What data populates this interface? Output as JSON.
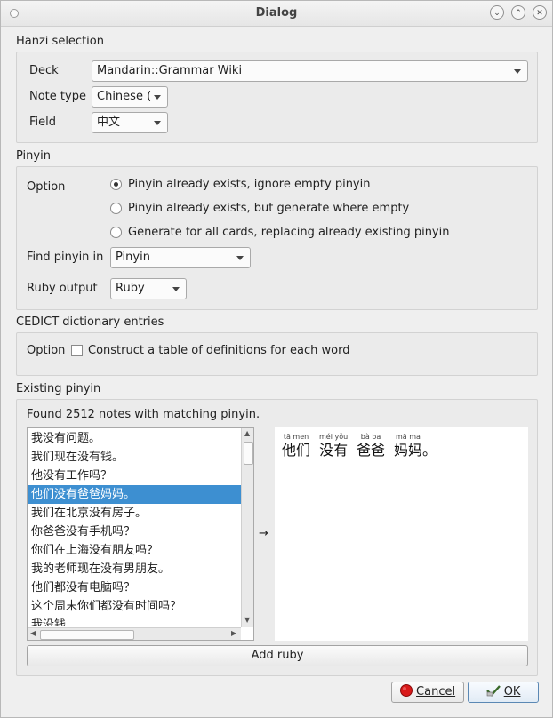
{
  "window": {
    "title": "Dialog"
  },
  "hanzi": {
    "title": "Hanzi selection",
    "deck_label": "Deck",
    "deck_value": "Mandarin::Grammar Wiki",
    "notetype_label": "Note type",
    "notetype_value": "Chinese (",
    "field_label": "Field",
    "field_value": "中文"
  },
  "pinyin": {
    "title": "Pinyin",
    "option_label": "Option",
    "radios": [
      {
        "label": "Pinyin already exists, ignore empty pinyin",
        "checked": true
      },
      {
        "label": "Pinyin already exists, but generate where empty",
        "checked": false
      },
      {
        "label": "Generate for all cards, replacing already existing pinyin",
        "checked": false
      }
    ],
    "find_label": "Find pinyin in",
    "find_value": "Pinyin",
    "ruby_label": "Ruby output",
    "ruby_value": "Ruby"
  },
  "cedict": {
    "title": "CEDICT dictionary entries",
    "option_label": "Option",
    "checkbox_label": "Construct a table of definitions for each word",
    "checked": false
  },
  "existing": {
    "title": "Existing pinyin",
    "found_text": "Found 2512 notes with matching pinyin.",
    "items": [
      "我没有问题。",
      "我们现在没有钱。",
      "他没有工作吗？",
      "他们没有爸爸妈妈。",
      "我们在北京没有房子。",
      "你爸爸没有手机吗？",
      "你们在上海没有朋友吗？",
      "我的老师现在没有男朋友。",
      "他们都没有电脑吗？",
      "这个周末你们都没有时间吗？",
      "我没钱。"
    ],
    "selected_index": 3,
    "arrow": "→",
    "preview": [
      {
        "rt": "tā men",
        "rb": "他们"
      },
      {
        "rt": "méi yǒu",
        "rb": "没有"
      },
      {
        "rt": "bà ba",
        "rb": "爸爸"
      },
      {
        "rt": "mā ma",
        "rb": "妈妈。"
      }
    ],
    "add_ruby_label": "Add ruby"
  },
  "buttons": {
    "cancel": "Cancel",
    "ok": "OK"
  },
  "icons": {
    "cancel": "stop-icon",
    "ok": "check-icon",
    "cancel_color": "#d91a1a"
  }
}
